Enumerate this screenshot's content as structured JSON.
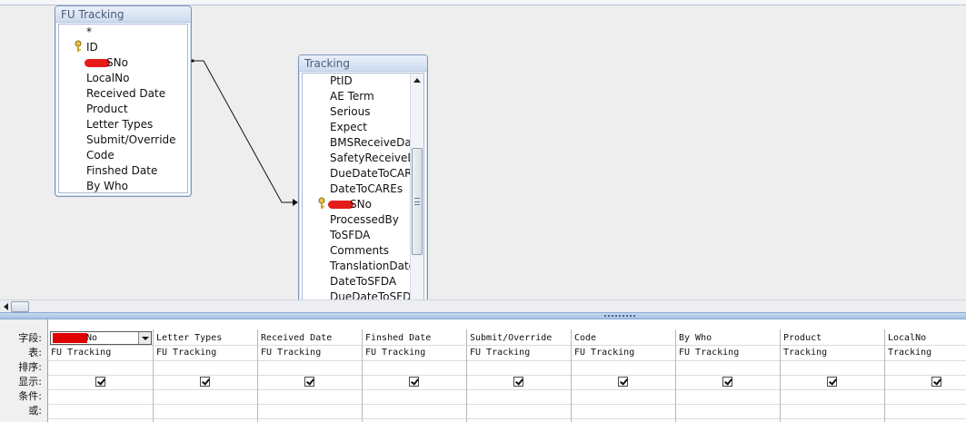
{
  "field_lists": {
    "fu_tracking": {
      "title": "FU Tracking",
      "fields": [
        "*",
        "ID",
        "SNo",
        "LocalNo",
        "Received Date",
        "Product",
        "Letter Types",
        "Submit/Override",
        "Code",
        "Finshed Date",
        "By Who"
      ]
    },
    "tracking": {
      "title": "Tracking",
      "fields": [
        "PtID",
        "AE Term",
        "Serious",
        "Expect",
        "BMSReceiveDat",
        "SafetyReceiveD",
        "DueDateToCAR",
        "DateToCAREs",
        "SNo",
        "ProcessedBy",
        "ToSFDA",
        "Comments",
        "TranslationDate",
        "DateToSFDA",
        "DueDateToSFD"
      ]
    }
  },
  "grid": {
    "row_labels": {
      "field": "字段:",
      "table": "表:",
      "sort": "排序:",
      "show": "显示:",
      "criteria": "条件:",
      "or": "或:"
    },
    "columns": [
      {
        "field": "No",
        "table": "FU Tracking",
        "show": true
      },
      {
        "field": "Letter Types",
        "table": "FU Tracking",
        "show": true
      },
      {
        "field": "Received Date",
        "table": "FU Tracking",
        "show": true
      },
      {
        "field": "Finshed Date",
        "table": "FU Tracking",
        "show": true
      },
      {
        "field": "Submit/Override",
        "table": "FU Tracking",
        "show": true
      },
      {
        "field": "Code",
        "table": "FU Tracking",
        "show": true
      },
      {
        "field": "By Who",
        "table": "FU Tracking",
        "show": true
      },
      {
        "field": "Product",
        "table": "Tracking",
        "show": true
      },
      {
        "field": "LocalNo",
        "table": "Tracking",
        "show": true
      }
    ]
  },
  "colors": {
    "redaction": "#e51b1b",
    "field_list_border": "#7b94b8",
    "splitter": "#a6c1e3"
  }
}
